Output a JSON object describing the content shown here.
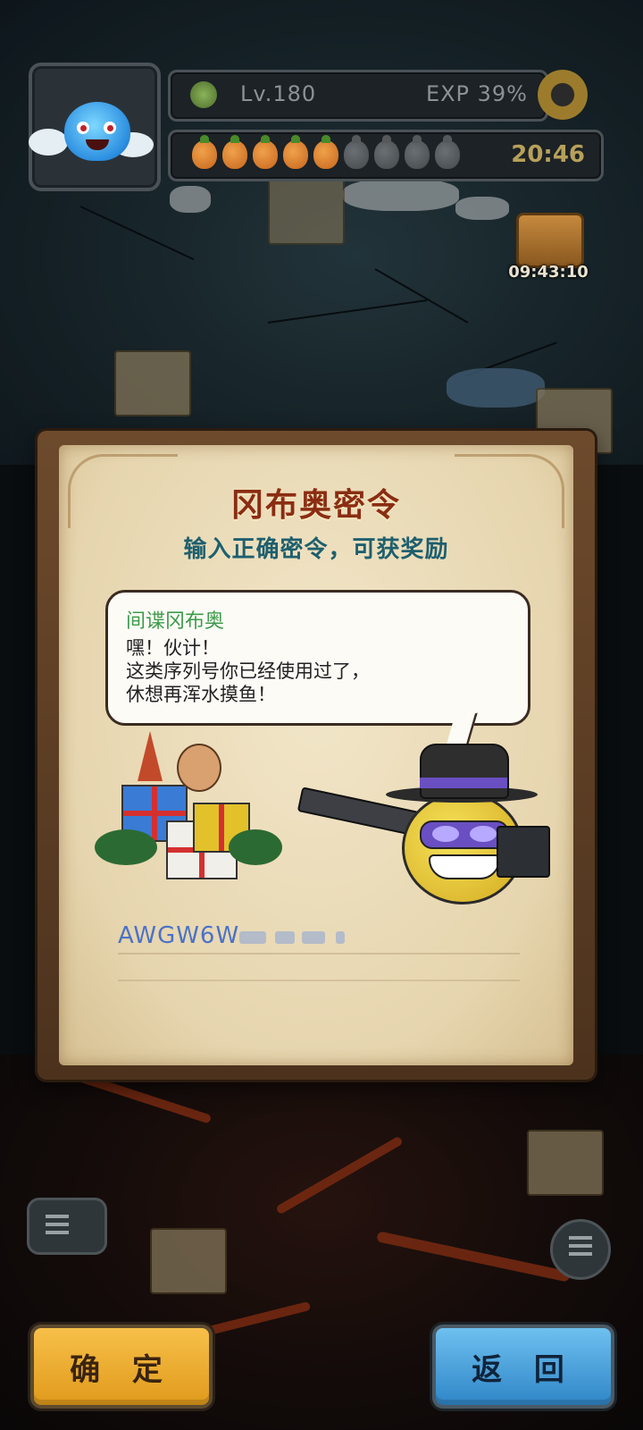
{
  "hud": {
    "level": "Lv.180",
    "exp": "EXP 39%",
    "energy": {
      "filled": 5,
      "total": 9
    },
    "energy_timer": "20:46",
    "event_timer": "09:43:10"
  },
  "dialog": {
    "title": "冈布奥密令",
    "subtitle": "输入正确密令，可获奖励",
    "speaker": "间谍冈布奥",
    "message_lines": [
      "嘿！伙计！",
      "这类序列号你已经使用过了，",
      "休想再浑水摸鱼！"
    ],
    "code_value": "AWGW6W"
  },
  "buttons": {
    "confirm": "确 定",
    "back": "返 回"
  },
  "colors": {
    "title": "#8a2d12",
    "subtitle": "#1e5f6e",
    "speaker": "#3d9b4a",
    "code": "#4a72c8",
    "confirm_button": "#f0b034",
    "back_button": "#4aa6df"
  }
}
